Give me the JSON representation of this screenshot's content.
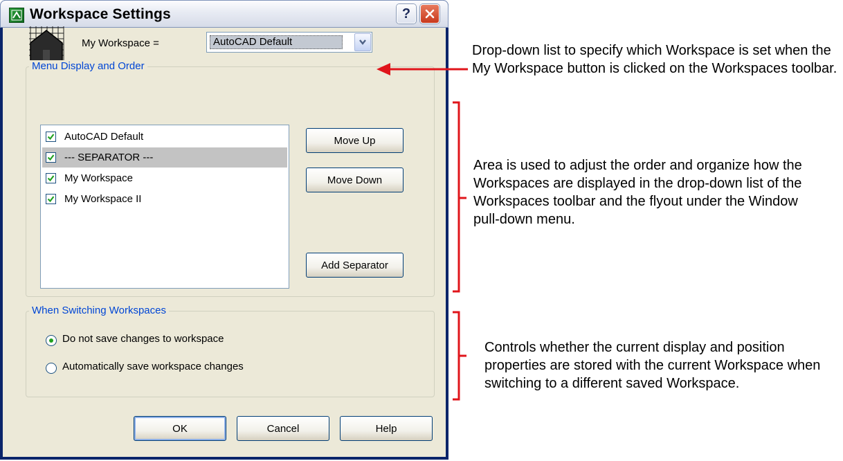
{
  "dialog": {
    "title": "Workspace Settings",
    "my_workspace_label": "My Workspace =",
    "my_workspace_value": "AutoCAD Default"
  },
  "menu_group": {
    "title": "Menu Display and Order",
    "items": [
      {
        "label": "AutoCAD Default",
        "checked": true
      },
      {
        "label": "--- SEPARATOR ---",
        "checked": true,
        "selected": true
      },
      {
        "label": "My Workspace",
        "checked": true
      },
      {
        "label": "My Workspace II",
        "checked": true
      }
    ],
    "move_up": "Move Up",
    "move_down": "Move Down",
    "add_separator": "Add Separator"
  },
  "switch_group": {
    "title": "When Switching Workspaces",
    "option1": "Do not save changes to workspace",
    "option2": "Automatically save workspace changes",
    "selected_option": 1
  },
  "buttons": {
    "ok": "OK",
    "cancel": "Cancel",
    "help": "Help"
  },
  "annotations": {
    "dropdown_note": "Drop-down list to specify which Workspace is set when the My Workspace button is clicked on the Workspaces toolbar.",
    "menu_note": "Area is used to adjust the order and organize how the Workspaces are displayed in the drop-down list of the Workspaces toolbar and the flyout under the Window pull-down menu.",
    "switch_note": "Controls whether the current display and position properties are stored with the current Workspace when switching to a different saved Workspace."
  },
  "colors": {
    "group_title": "#0046d5",
    "annotation_line": "#e0151b"
  }
}
